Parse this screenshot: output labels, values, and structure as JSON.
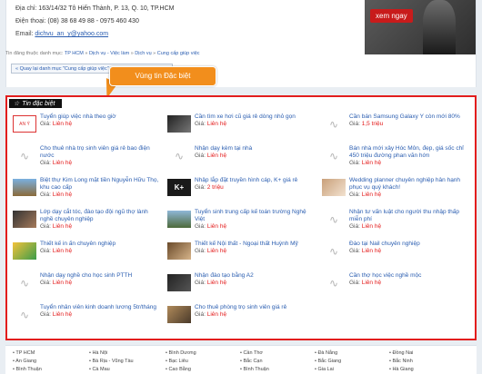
{
  "contact": {
    "address_label": "Địa chỉ:",
    "address_value": "163/14/32 Tô Hiến Thành, P. 13, Q. 10, TP.HCM",
    "phone_label": "Điện thoại:",
    "phone_value": "(08) 38 68 49 88 - 0975 460 430",
    "email_label": "Email:",
    "email_value": "dichvu_an_y@yahoo.com"
  },
  "promo": {
    "button": "xem ngay"
  },
  "breadcrumb": {
    "prefix": "Tin đăng thuộc danh mục:",
    "items": [
      "TP HCM",
      "Dịch vụ - Việc làm",
      "Dịch vụ",
      "Cung cấp giúp việc"
    ]
  },
  "back_link": "« Quay lại danh mục \"Cung cấp giúp việc\"",
  "callout": "Vùng tin Đặc biệt",
  "special": {
    "tag": "Tin đặc biệt",
    "items": [
      {
        "title": "Tuyển giúp việc nhà theo giờ",
        "price_label": "Giá:",
        "price": "Liên hệ",
        "thumb": "logo"
      },
      {
        "title": "Cần tìm xe hơi cũ giá rẻ dòng nhỏ gọn",
        "price_label": "Giá:",
        "price": "Liên hệ",
        "thumb": "car"
      },
      {
        "title": "Cần bán Samsung Galaxy Y còn mới 80%",
        "price_label": "Giá:",
        "price": "1,5 triệu",
        "thumb": "none"
      },
      {
        "title": "Cho thuê nhà trọ sinh viên giá rẻ bao điện nước",
        "price_label": "Giá:",
        "price": "Liên hệ",
        "thumb": "none"
      },
      {
        "title": "Nhận dạy kèm tại nhà",
        "price_label": "Giá:",
        "price": "Liên hệ",
        "thumb": "none"
      },
      {
        "title": "Bán nhà mới xây Hóc Môn, đẹp, giá sốc chỉ 450 triệu đường phan văn hớn",
        "price_label": "Giá:",
        "price": "Liên hệ",
        "thumb": "none"
      },
      {
        "title": "Biệt thự Kim Long mặt tiền Nguyễn Hữu Thọ, khu cao cấp",
        "price_label": "Giá:",
        "price": "Liên hệ",
        "thumb": "house"
      },
      {
        "title": "Nhập lắp đặt truyền hình cáp, K+ giá rẻ",
        "price_label": "Giá:",
        "price": "2 triệu",
        "thumb": "kplus"
      },
      {
        "title": "Wedding planner chuyên nghiệp hân hạnh phục vụ quý khách!",
        "price_label": "Giá:",
        "price": "Liên hệ",
        "thumb": "wedding"
      },
      {
        "title": "Lớp dạy cắt tóc, đào tạo đội ngũ thợ lành nghề chuyên nghiệp",
        "price_label": "Giá:",
        "price": "Liên hệ",
        "thumb": "hair"
      },
      {
        "title": "Tuyển sinh trung cấp kế toán trường Nghệ Việt",
        "price_label": "Giá:",
        "price": "Liên hệ",
        "thumb": "school"
      },
      {
        "title": "Nhận tư vấn luật cho người thu nhập thấp miễn phí",
        "price_label": "Giá:",
        "price": "Liên hệ",
        "thumb": "none"
      },
      {
        "title": "Thiết kế in ấn chuyên nghiệp",
        "price_label": "Giá:",
        "price": "Liên hệ",
        "thumb": "print"
      },
      {
        "title": "Thiết kế Nội thất - Ngoại thất Huỳnh Mỹ",
        "price_label": "Giá:",
        "price": "Liên hệ",
        "thumb": "interior"
      },
      {
        "title": "Đào tại Nail chuyên nghiệp",
        "price_label": "Giá:",
        "price": "Liên hệ",
        "thumb": "none"
      },
      {
        "title": "Nhận dạy nghề cho học sinh PTTH",
        "price_label": "Giá:",
        "price": "Liên hệ",
        "thumb": "none"
      },
      {
        "title": "Nhận đào tạo bằng A2",
        "price_label": "Giá:",
        "price": "Liên hệ",
        "thumb": "moto"
      },
      {
        "title": "Cần thợ học việc nghề mộc",
        "price_label": "Giá:",
        "price": "Liên hệ",
        "thumb": "none"
      },
      {
        "title": "Tuyển nhân viên kinh doanh lương 5tr/tháng",
        "price_label": "Giá:",
        "price": "Liên hệ",
        "thumb": "none"
      },
      {
        "title": "Cho thuê phòng trọ sinh viên giá rẻ",
        "price_label": "Giá:",
        "price": "Liên hệ",
        "thumb": "room"
      },
      {
        "title": "",
        "price_label": "",
        "price": "",
        "thumb": "empty"
      }
    ]
  },
  "footer": {
    "columns": [
      [
        "TP HCM",
        "An Giang",
        "Bình Thuận"
      ],
      [
        "Hà Nội",
        "Bà Rịa - Vũng Tàu",
        "Cà Mau"
      ],
      [
        "Bình Dương",
        "Bạc Liêu",
        "Cao Bằng"
      ],
      [
        "Cần Thơ",
        "Bắc Cạn",
        "Bình Thuận"
      ],
      [
        "Đà Nẵng",
        "Bắc Giang",
        "Gia Lai"
      ],
      [
        "Đồng Nai",
        "Bắc Ninh",
        "Hà Giang"
      ]
    ]
  },
  "colors": {
    "accent_red": "#e21d1d",
    "link_blue": "#2a5db0",
    "callout_orange": "#f28e1c"
  }
}
